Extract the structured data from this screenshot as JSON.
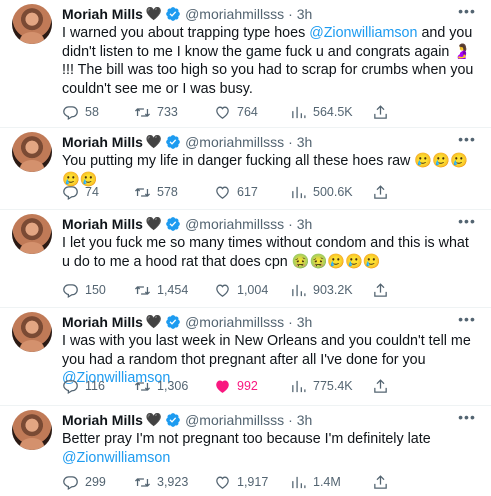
{
  "tweets": [
    {
      "name": "Moriah Mills",
      "heart": "🖤",
      "handle": "@moriahmillsss",
      "dot": "·",
      "time": "3h",
      "text_parts": [
        {
          "t": "I warned you about trapping type hoes "
        },
        {
          "t": "@Zionwilliamson",
          "mention": true
        },
        {
          "t": " and you didn't listen to me I know the game fuck u and congrats again 🤰 !!! The bill was too high so you had to scrap for crumbs when you couldn't see me or I was busy."
        }
      ],
      "replies": "58",
      "retweets": "733",
      "likes": "764",
      "views": "564.5K",
      "liked": false
    },
    {
      "name": "Moriah Mills",
      "heart": "🖤",
      "handle": "@moriahmillsss",
      "dot": "·",
      "time": "3h",
      "text_parts": [
        {
          "t": "You putting my life in danger fucking all these hoes raw 🥲🥲🥲🥲🥲"
        }
      ],
      "replies": "74",
      "retweets": "578",
      "likes": "617",
      "views": "500.6K",
      "liked": false
    },
    {
      "name": "Moriah Mills",
      "heart": "🖤",
      "handle": "@moriahmillsss",
      "dot": "·",
      "time": "3h",
      "text_parts": [
        {
          "t": "I let you fuck me so many times without condom and this is what u do to me a hood rat that does cpn 🤢🤢🥲🥲🥲"
        }
      ],
      "replies": "150",
      "retweets": "1,454",
      "likes": "1,004",
      "views": "903.2K",
      "liked": false
    },
    {
      "name": "Moriah Mills",
      "heart": "🖤",
      "handle": "@moriahmillsss",
      "dot": "·",
      "time": "3h",
      "text_parts": [
        {
          "t": "I was with you last week in New Orleans and you couldn't tell me you had a random thot pregnant after all I've done for you "
        },
        {
          "t": "@Zionwilliamson",
          "mention": true
        }
      ],
      "replies": "116",
      "retweets": "1,306",
      "likes": "992",
      "views": "775.4K",
      "liked": true
    },
    {
      "name": "Moriah Mills",
      "heart": "🖤",
      "handle": "@moriahmillsss",
      "dot": "·",
      "time": "3h",
      "text_parts": [
        {
          "t": "Better pray I'm not pregnant too because I'm definitely late "
        },
        {
          "t": "@Zionwilliamson",
          "mention": true
        }
      ],
      "replies": "299",
      "retweets": "3,923",
      "likes": "1,917",
      "views": "1.4M",
      "liked": false
    }
  ],
  "colors": {
    "accent": "#1d9bf0",
    "like_active": "#f91880",
    "muted": "#536471",
    "verified": "#1d9bf0"
  },
  "icons": {
    "more": "more-horizontal-icon",
    "reply": "reply-icon",
    "retweet": "retweet-icon",
    "like": "heart-icon",
    "views": "views-icon",
    "share": "share-icon",
    "verified": "verified-badge-icon"
  }
}
